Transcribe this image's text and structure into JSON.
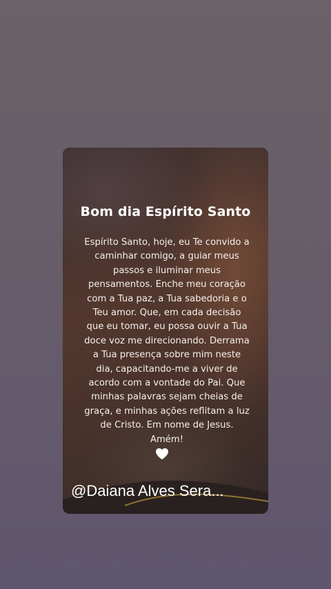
{
  "post": {
    "title": "Bom dia Espírito Santo",
    "body": "Espírito Santo, hoje, eu Te convido a caminhar comigo, a guiar meus passos e iluminar meus pensamentos. Enche meu coração com a Tua paz, a Tua sabedoria e o Teu amor. Que, em cada decisão que eu tomar, eu possa ouvir a Tua doce voz me direcionando. Derrama a Tua presença sobre mim neste dia, capacitando-me a viver de acordo com a vontade do Pai. Que minhas palavras sejam cheias de graça, e minhas ações reflitam a luz de Cristo. Em nome de Jesus. Amém!",
    "heart_icon": "heart-icon",
    "author_handle": "@Daiana Alves Sera..."
  },
  "colors": {
    "background_top": "#6b6168",
    "background_bottom": "#5f5670",
    "text": "#ffffff"
  }
}
